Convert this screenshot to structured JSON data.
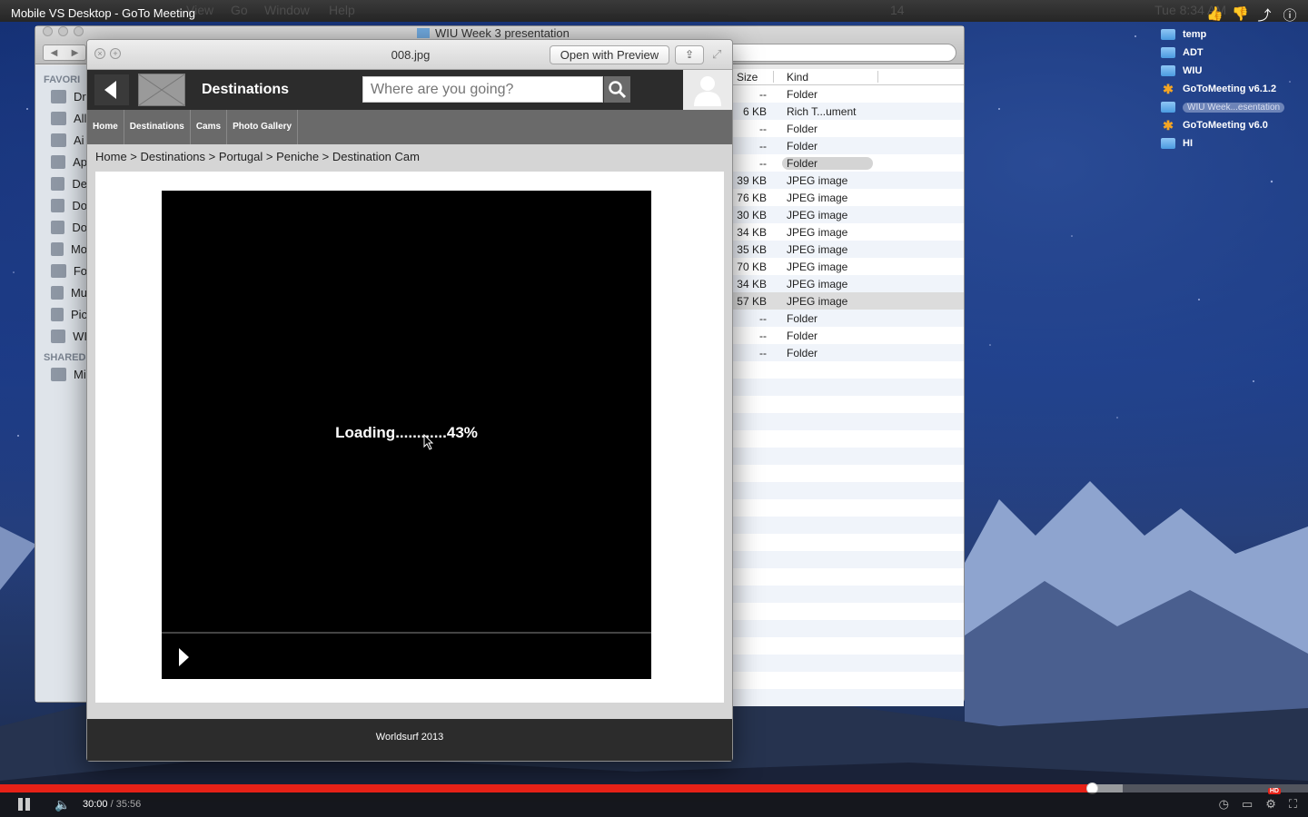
{
  "video": {
    "title": "Mobile VS Desktop - GoTo Meeting",
    "current_time": "30:00",
    "separator": " / ",
    "duration": "35:56",
    "progress": 0.835,
    "buffered": 0.858
  },
  "menubar": {
    "items": [
      "View",
      "Go",
      "Window",
      "Help"
    ],
    "clock": "Tue 8:34 AM",
    "badge": "14"
  },
  "desktop_icons": [
    {
      "label": "temp",
      "icon": "folder-icon"
    },
    {
      "label": "ADT",
      "icon": "folder-icon"
    },
    {
      "label": "WIU",
      "icon": "folder-icon"
    },
    {
      "label": "GoToMeeting v6.1.2",
      "icon": "gotomeeting-icon"
    },
    {
      "label": "WIU Week...esentation",
      "icon": "folder-icon"
    },
    {
      "label": "GoToMeeting v6.0",
      "icon": "gotomeeting-icon"
    },
    {
      "label": "HI",
      "icon": "folder-icon"
    }
  ],
  "finder": {
    "title": "WIU Week 3 presentation",
    "sidebar_sections": {
      "favorites": "FAVORI",
      "shared": "SHARED"
    },
    "sidebar_items": [
      "Dr",
      "All",
      "Ai",
      "Ap",
      "De",
      "Do",
      "Do",
      "Mo",
      "Fo",
      "Mu",
      "Pic",
      "WI"
    ],
    "shared_items": [
      "Mi"
    ],
    "columns": {
      "size": "Size",
      "kind": "Kind"
    },
    "rows": [
      {
        "size": "--",
        "kind": "Folder"
      },
      {
        "size": "6 KB",
        "kind": "Rich T...ument"
      },
      {
        "size": "--",
        "kind": "Folder"
      },
      {
        "size": "--",
        "kind": "Folder"
      },
      {
        "size": "--",
        "kind": "Folder"
      },
      {
        "size": "39 KB",
        "kind": "JPEG image"
      },
      {
        "size": "76 KB",
        "kind": "JPEG image"
      },
      {
        "size": "30 KB",
        "kind": "JPEG image"
      },
      {
        "size": "34 KB",
        "kind": "JPEG image"
      },
      {
        "size": "35 KB",
        "kind": "JPEG image"
      },
      {
        "size": "70 KB",
        "kind": "JPEG image"
      },
      {
        "size": "34 KB",
        "kind": "JPEG image"
      },
      {
        "size": "57 KB",
        "kind": "JPEG image"
      },
      {
        "size": "--",
        "kind": "Folder"
      },
      {
        "size": "--",
        "kind": "Folder"
      },
      {
        "size": "--",
        "kind": "Folder"
      }
    ]
  },
  "preview": {
    "filename": "008.jpg",
    "open_with": "Open with Preview"
  },
  "app": {
    "title": "Destinations",
    "search_placeholder": "Where are you going?",
    "nav": [
      "Home",
      "Destinations",
      "Cams",
      "Photo Gallery"
    ],
    "breadcrumb": "Home > Destinations > Portugal > Peniche > Destination Cam",
    "loading_text": "Loading............43%",
    "loading_progress": 0.43,
    "footer": "Worldsurf 2013"
  }
}
